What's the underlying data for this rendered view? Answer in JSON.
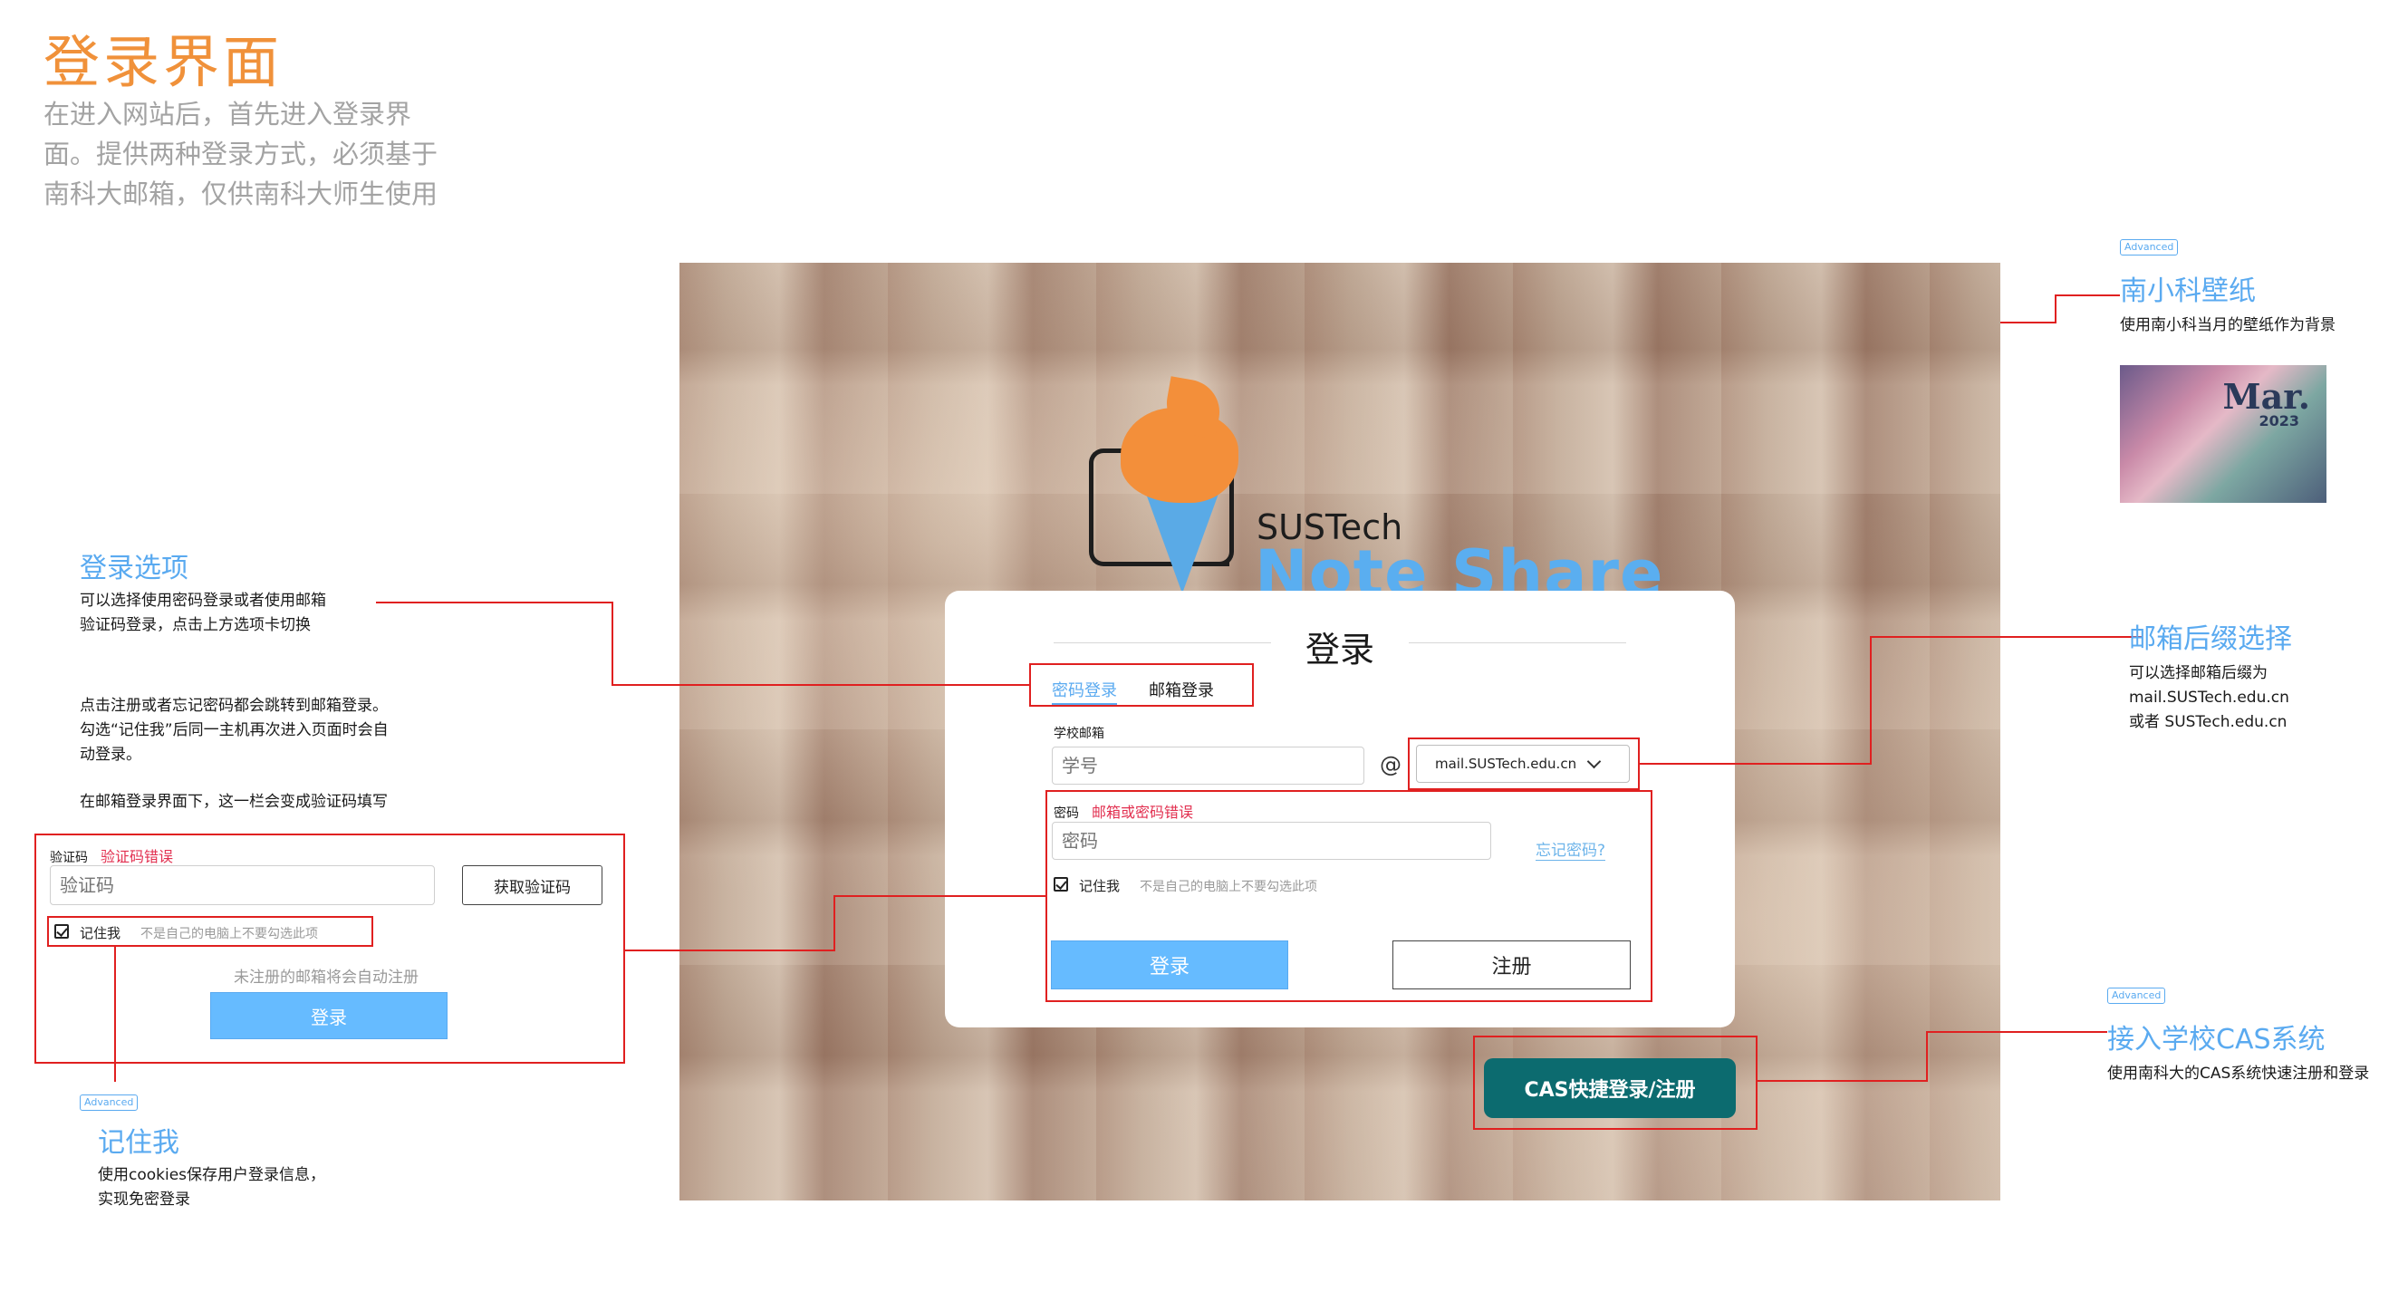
{
  "page": {
    "title": "登录界面",
    "intro_lines": [
      "在进入网站后，首先进入登录界",
      "面。提供两种登录方式，必须基于",
      "南科大邮箱，仅供南科大师生使用"
    ]
  },
  "logo": {
    "line1": "SUSTech",
    "line2": "Note Share"
  },
  "login": {
    "title": "登录",
    "tabs": [
      {
        "label": "密码登录",
        "active": true
      },
      {
        "label": "邮箱登录",
        "active": false
      }
    ],
    "email_label": "学校邮箱",
    "email_placeholder": "学号",
    "at": "@",
    "domain_selected": "mail.SUSTech.edu.cn",
    "password_label": "密码",
    "password_error": "邮箱或密码错误",
    "password_placeholder": "密码",
    "forgot": "忘记密码?",
    "remember": "记住我",
    "remember_hint": "不是自己的电脑上不要勾选此项",
    "login_button": "登录",
    "register_button": "注册",
    "cas_button": "CAS快捷登录/注册"
  },
  "annotations": {
    "wallpaper": {
      "badge": "Advanced",
      "title": "南小科壁纸",
      "text": "使用南小科当月的壁纸作为背景",
      "image_month": "Mar.",
      "image_year": "2023"
    },
    "login_options": {
      "title": "登录选项",
      "text_lines": [
        "可以选择使用密码登录或者使用邮箱",
        "验证码登录，点击上方选项卡切换"
      ],
      "para2_lines": [
        "点击注册或者忘记密码都会跳转到邮箱登录。",
        "勾选“记住我”后同一主机再次进入页面时会自",
        "动登录。"
      ],
      "para3": "在邮箱登录界面下，这一栏会变成验证码填写"
    },
    "domain": {
      "title": "邮箱后缀选择",
      "text_lines": [
        "可以选择邮箱后缀为",
        "mail.SUSTech.edu.cn",
        "或者 SUSTech.edu.cn"
      ]
    },
    "cas": {
      "badge": "Advanced",
      "title": "接入学校CAS系统",
      "text": "使用南科大的CAS系统快速注册和登录"
    },
    "remember": {
      "badge": "Advanced",
      "title": "记住我",
      "text_lines": [
        "使用cookies保存用户登录信息，",
        "实现免密登录"
      ]
    }
  },
  "demo": {
    "code_label": "验证码",
    "code_error": "验证码错误",
    "code_placeholder": "验证码",
    "get_code_button": "获取验证码",
    "remember": "记住我",
    "remember_hint": "不是自己的电脑上不要勾选此项",
    "note": "未注册的邮箱将会自动注册",
    "login_button": "登录"
  },
  "colors": {
    "accent": "#5aaaf0",
    "title": "#f0913a",
    "error": "#e23050",
    "cas": "#0c6b6f",
    "highlight": "#e02020"
  }
}
